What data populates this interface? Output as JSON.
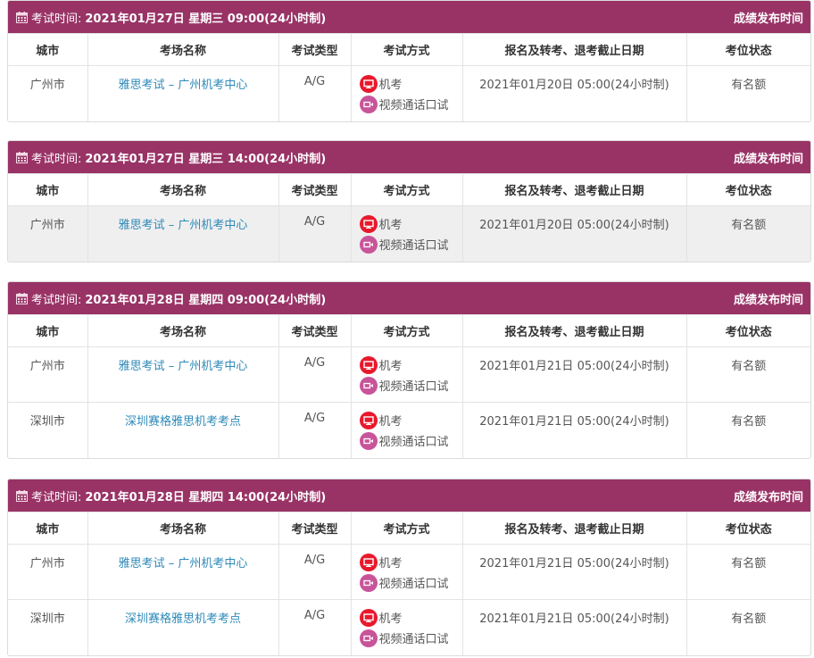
{
  "columns": [
    "城市",
    "考场名称",
    "考试类型",
    "考试方式",
    "报名及转考、退考截止日期",
    "考位状态"
  ],
  "header_label": "考试时间:",
  "header_right": "成绩发布时间",
  "mode_computer": "机考",
  "mode_video": "视频通话口试",
  "sessions": [
    {
      "time": "2021年01月27日 星期三 09:00(24小时制)",
      "rows": [
        {
          "city": "广州市",
          "venue": "雅思考试 – 广州机考中心",
          "type": "A/G",
          "deadline": "2021年01月20日 05:00(24小时制)",
          "status": "有名额"
        }
      ]
    },
    {
      "time": "2021年01月27日 星期三 14:00(24小时制)",
      "rows": [
        {
          "city": "广州市",
          "venue": "雅思考试 – 广州机考中心",
          "type": "A/G",
          "deadline": "2021年01月20日 05:00(24小时制)",
          "status": "有名额"
        }
      ]
    },
    {
      "time": "2021年01月28日 星期四 09:00(24小时制)",
      "rows": [
        {
          "city": "广州市",
          "venue": "雅思考试 – 广州机考中心",
          "type": "A/G",
          "deadline": "2021年01月21日 05:00(24小时制)",
          "status": "有名额"
        },
        {
          "city": "深圳市",
          "venue": "深圳赛格雅思机考考点",
          "type": "A/G",
          "deadline": "2021年01月21日 05:00(24小时制)",
          "status": "有名额"
        }
      ]
    },
    {
      "time": "2021年01月28日 星期四 14:00(24小时制)",
      "rows": [
        {
          "city": "广州市",
          "venue": "雅思考试 – 广州机考中心",
          "type": "A/G",
          "deadline": "2021年01月21日 05:00(24小时制)",
          "status": "有名额"
        },
        {
          "city": "深圳市",
          "venue": "深圳赛格雅思机考考点",
          "type": "A/G",
          "deadline": "2021年01月21日 05:00(24小时制)",
          "status": "有名额"
        }
      ]
    }
  ],
  "colors": {
    "header_bg": "#993366",
    "link": "#2e8ab8",
    "computer_icon": "#e8192c",
    "video_icon": "#c8549a",
    "shaded_row": "#efefef"
  },
  "icons": {
    "header": "calendar-icon",
    "computer": "monitor-icon",
    "video": "video-camera-icon"
  }
}
